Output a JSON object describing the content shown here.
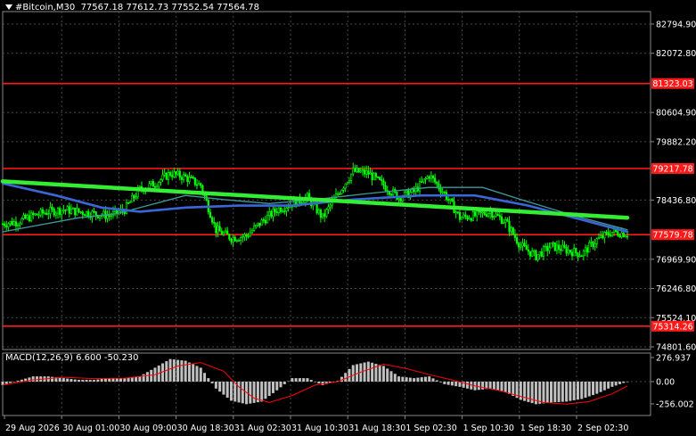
{
  "header": {
    "symbol": "#Bitcoin,M30",
    "ohlc": "77567.18 77612.73 77552.54 77564.78"
  },
  "indicator_label": "MACD(12,26,9) 6.600 -50.230",
  "colors": {
    "background": "#000000",
    "grid": "#4a4a4a",
    "candle": "#00ff00",
    "sma_fast": "#3d9a9a",
    "sma_slow": "#3a66d6",
    "trend": "#33ee33",
    "level": "#ff1a1a",
    "histogram": "#c0c0c0",
    "signal": "#ff0000"
  },
  "chart_data": [
    {
      "type": "candlestick",
      "title": "#Bitcoin,M30",
      "y_ticks": [
        82794.9,
        82072.8,
        80604.9,
        79882.2,
        78436.8,
        76969.9,
        76246.8,
        75524.1,
        74801.6
      ],
      "ylim": [
        74750,
        83200
      ],
      "x_ticks": [
        "29 Aug 2026",
        "30 Aug 01:00",
        "30 Aug 09:00",
        "30 Aug 18:30",
        "31 Aug 02:30",
        "31 Aug 10:30",
        "31 Aug 18:30",
        "1 Sep 02:30",
        "1 Sep 10:30",
        "1 Sep 18:30",
        "2 Sep 02:30"
      ],
      "grid": true,
      "price_path": [
        {
          "x": 0,
          "y": 77850
        },
        {
          "x": 4,
          "y": 77900
        },
        {
          "x": 8,
          "y": 78050
        },
        {
          "x": 12,
          "y": 78150
        },
        {
          "x": 16,
          "y": 78200
        },
        {
          "x": 20,
          "y": 78150
        },
        {
          "x": 24,
          "y": 78100
        },
        {
          "x": 28,
          "y": 78050
        },
        {
          "x": 32,
          "y": 78200
        },
        {
          "x": 36,
          "y": 78700
        },
        {
          "x": 40,
          "y": 78850
        },
        {
          "x": 44,
          "y": 79100
        },
        {
          "x": 48,
          "y": 79000
        },
        {
          "x": 52,
          "y": 78800
        },
        {
          "x": 56,
          "y": 77700
        },
        {
          "x": 60,
          "y": 77500
        },
        {
          "x": 64,
          "y": 77550
        },
        {
          "x": 68,
          "y": 77900
        },
        {
          "x": 72,
          "y": 78200
        },
        {
          "x": 76,
          "y": 78350
        },
        {
          "x": 80,
          "y": 78500
        },
        {
          "x": 84,
          "y": 78000
        },
        {
          "x": 88,
          "y": 78600
        },
        {
          "x": 92,
          "y": 79150
        },
        {
          "x": 96,
          "y": 79100
        },
        {
          "x": 100,
          "y": 78800
        },
        {
          "x": 104,
          "y": 78500
        },
        {
          "x": 108,
          "y": 78650
        },
        {
          "x": 112,
          "y": 79050
        },
        {
          "x": 116,
          "y": 78600
        },
        {
          "x": 120,
          "y": 78000
        },
        {
          "x": 124,
          "y": 78050
        },
        {
          "x": 128,
          "y": 78150
        },
        {
          "x": 132,
          "y": 77900
        },
        {
          "x": 136,
          "y": 77300
        },
        {
          "x": 140,
          "y": 77050
        },
        {
          "x": 144,
          "y": 77300
        },
        {
          "x": 148,
          "y": 77200
        },
        {
          "x": 152,
          "y": 77100
        },
        {
          "x": 156,
          "y": 77450
        },
        {
          "x": 160,
          "y": 77650
        },
        {
          "x": 164,
          "y": 77600
        }
      ],
      "series": [
        {
          "name": "",
          "kind": "sma_fast",
          "values": [
            {
              "x": 0,
              "y": 77650
            },
            {
              "x": 20,
              "y": 78000
            },
            {
              "x": 30,
              "y": 78100
            },
            {
              "x": 38,
              "y": 78300
            },
            {
              "x": 48,
              "y": 78550
            },
            {
              "x": 58,
              "y": 78450
            },
            {
              "x": 70,
              "y": 78350
            },
            {
              "x": 82,
              "y": 78450
            },
            {
              "x": 96,
              "y": 78600
            },
            {
              "x": 112,
              "y": 78750
            },
            {
              "x": 126,
              "y": 78750
            },
            {
              "x": 136,
              "y": 78450
            },
            {
              "x": 150,
              "y": 78050
            },
            {
              "x": 164,
              "y": 77700
            }
          ]
        },
        {
          "name": "",
          "kind": "sma_slow",
          "values": [
            {
              "x": 0,
              "y": 78850
            },
            {
              "x": 14,
              "y": 78550
            },
            {
              "x": 26,
              "y": 78250
            },
            {
              "x": 36,
              "y": 78150
            },
            {
              "x": 48,
              "y": 78250
            },
            {
              "x": 62,
              "y": 78300
            },
            {
              "x": 76,
              "y": 78300
            },
            {
              "x": 92,
              "y": 78450
            },
            {
              "x": 110,
              "y": 78550
            },
            {
              "x": 124,
              "y": 78550
            },
            {
              "x": 138,
              "y": 78300
            },
            {
              "x": 152,
              "y": 77950
            },
            {
              "x": 164,
              "y": 77650
            }
          ]
        },
        {
          "name": "",
          "kind": "trend",
          "values": [
            {
              "x": 0,
              "y": 78900
            },
            {
              "x": 164,
              "y": 78000
            }
          ]
        }
      ],
      "levels": [
        81323.03,
        79217.78,
        77579.78,
        75314.26
      ],
      "level_labels": [
        "81323.03",
        "79217.78",
        "77579.78",
        "75314.26"
      ]
    },
    {
      "type": "bar",
      "title": "MACD(12,26,9) 6.600 -50.230",
      "y_ticks": [
        276.937,
        0.0,
        -256.002
      ],
      "y_tick_labels": [
        "276.937",
        "0.00",
        "-256.002"
      ],
      "ylim": [
        -300,
        320
      ],
      "histogram": [
        {
          "x": 0,
          "y": -40
        },
        {
          "x": 4,
          "y": 10
        },
        {
          "x": 8,
          "y": 60
        },
        {
          "x": 12,
          "y": 60
        },
        {
          "x": 16,
          "y": 40
        },
        {
          "x": 20,
          "y": 20
        },
        {
          "x": 24,
          "y": 20
        },
        {
          "x": 28,
          "y": 40
        },
        {
          "x": 32,
          "y": 40
        },
        {
          "x": 36,
          "y": 60
        },
        {
          "x": 40,
          "y": 160
        },
        {
          "x": 44,
          "y": 260
        },
        {
          "x": 48,
          "y": 240
        },
        {
          "x": 52,
          "y": 160
        },
        {
          "x": 56,
          "y": -80
        },
        {
          "x": 60,
          "y": -220
        },
        {
          "x": 64,
          "y": -260
        },
        {
          "x": 68,
          "y": -230
        },
        {
          "x": 72,
          "y": -100
        },
        {
          "x": 76,
          "y": 40
        },
        {
          "x": 80,
          "y": 40
        },
        {
          "x": 84,
          "y": -40
        },
        {
          "x": 88,
          "y": 10
        },
        {
          "x": 92,
          "y": 190
        },
        {
          "x": 96,
          "y": 230
        },
        {
          "x": 100,
          "y": 180
        },
        {
          "x": 104,
          "y": 60
        },
        {
          "x": 108,
          "y": 40
        },
        {
          "x": 112,
          "y": 60
        },
        {
          "x": 116,
          "y": -30
        },
        {
          "x": 120,
          "y": -60
        },
        {
          "x": 124,
          "y": -100
        },
        {
          "x": 128,
          "y": -80
        },
        {
          "x": 132,
          "y": -120
        },
        {
          "x": 136,
          "y": -210
        },
        {
          "x": 140,
          "y": -260
        },
        {
          "x": 144,
          "y": -240
        },
        {
          "x": 148,
          "y": -230
        },
        {
          "x": 152,
          "y": -200
        },
        {
          "x": 156,
          "y": -140
        },
        {
          "x": 160,
          "y": -60
        },
        {
          "x": 164,
          "y": 0
        }
      ],
      "signal": [
        {
          "x": 0,
          "y": -40
        },
        {
          "x": 8,
          "y": 20
        },
        {
          "x": 16,
          "y": 50
        },
        {
          "x": 24,
          "y": 35
        },
        {
          "x": 32,
          "y": 40
        },
        {
          "x": 40,
          "y": 80
        },
        {
          "x": 46,
          "y": 180
        },
        {
          "x": 52,
          "y": 220
        },
        {
          "x": 58,
          "y": 120
        },
        {
          "x": 62,
          "y": -60
        },
        {
          "x": 66,
          "y": -190
        },
        {
          "x": 70,
          "y": -240
        },
        {
          "x": 76,
          "y": -160
        },
        {
          "x": 82,
          "y": -40
        },
        {
          "x": 88,
          "y": 0
        },
        {
          "x": 94,
          "y": 110
        },
        {
          "x": 100,
          "y": 200
        },
        {
          "x": 106,
          "y": 150
        },
        {
          "x": 112,
          "y": 80
        },
        {
          "x": 118,
          "y": 20
        },
        {
          "x": 124,
          "y": -50
        },
        {
          "x": 130,
          "y": -100
        },
        {
          "x": 136,
          "y": -170
        },
        {
          "x": 142,
          "y": -240
        },
        {
          "x": 148,
          "y": -260
        },
        {
          "x": 154,
          "y": -230
        },
        {
          "x": 160,
          "y": -140
        },
        {
          "x": 164,
          "y": -50
        }
      ]
    }
  ]
}
